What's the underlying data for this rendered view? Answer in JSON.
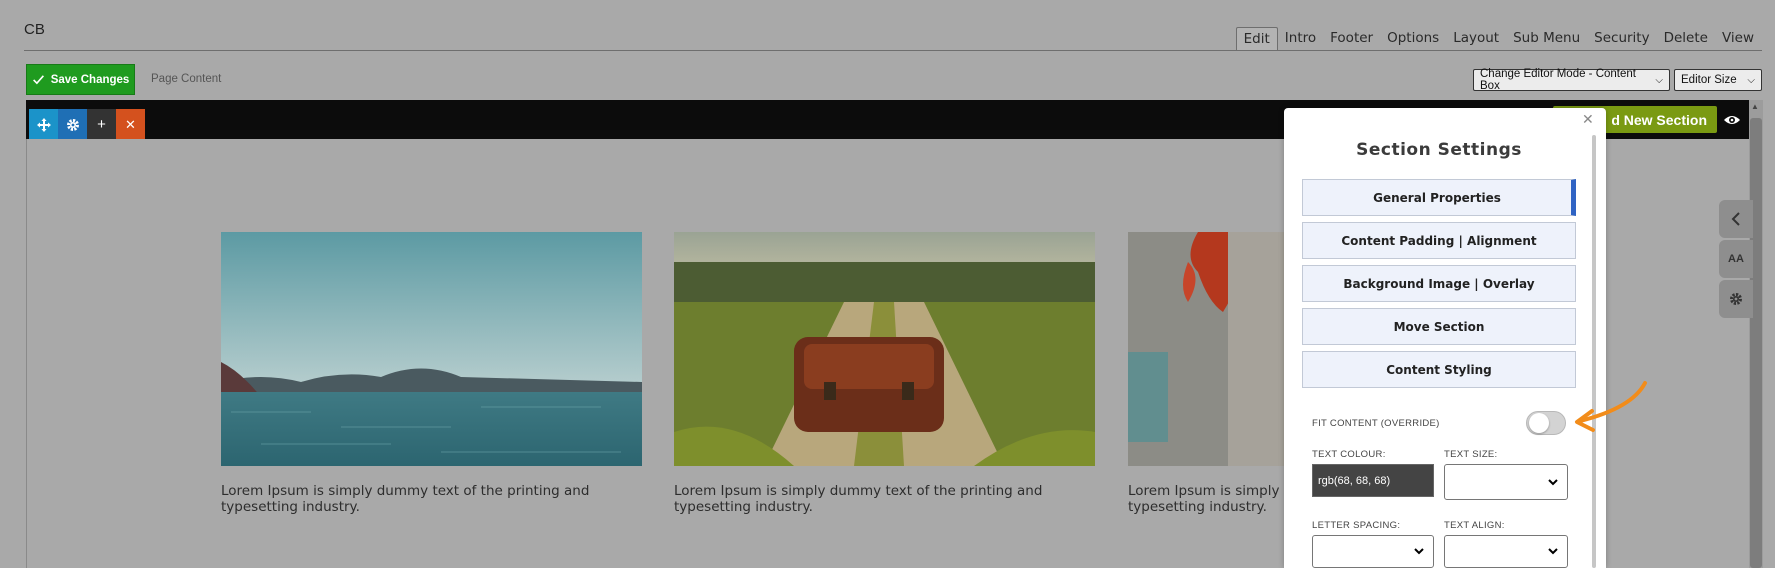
{
  "header": {
    "site_name": "CB",
    "tabs": [
      {
        "label": "Edit",
        "active": true
      },
      {
        "label": "Intro"
      },
      {
        "label": "Footer"
      },
      {
        "label": "Options"
      },
      {
        "label": "Layout"
      },
      {
        "label": "Sub Menu"
      },
      {
        "label": "Security"
      },
      {
        "label": "Delete"
      },
      {
        "label": "View"
      }
    ]
  },
  "toolbar": {
    "save_label": "Save Changes",
    "page_content_label": "Page Content",
    "editor_mode_select": "Change Editor Mode - Content Box",
    "editor_size_select": "Editor Size"
  },
  "section_bar": {
    "add_section_label": "d New Section",
    "tool_icons": [
      "move-icon",
      "gear-icon",
      "plus-icon",
      "close-icon"
    ]
  },
  "cards": [
    {
      "text": "Lorem Ipsum is simply dummy text of the printing and typesetting industry.",
      "image": "sea-landscape"
    },
    {
      "text": "Lorem Ipsum is simply dummy text of the printing and typesetting industry.",
      "image": "leather-bag-on-path"
    },
    {
      "text": "Lorem Ipsum is simply",
      "text2": "typesetting industry.",
      "image": "red-leaf"
    }
  ],
  "side_tabs": [
    {
      "icon": "chevron-left-icon"
    },
    {
      "icon": "font-size-icon",
      "label": "AA"
    },
    {
      "icon": "gear-icon"
    }
  ],
  "panel": {
    "title": "Section Settings",
    "buttons": [
      {
        "label": "General Properties",
        "active": true
      },
      {
        "label": "Content Padding | Alignment"
      },
      {
        "label": "Background Image | Overlay"
      },
      {
        "label": "Move Section"
      },
      {
        "label": "Content Styling"
      }
    ],
    "fit_content_label": "FIT CONTENT (OVERRIDE)",
    "fit_content_on": false,
    "text_colour_label": "TEXT COLOUR:",
    "text_colour_value": "rgb(68, 68, 68)",
    "text_size_label": "TEXT SIZE:",
    "letter_spacing_label": "LETTER SPACING:",
    "text_align_label": "TEXT ALIGN:"
  },
  "colors": {
    "save_green": "#1f9b1f",
    "add_section_green": "#7a9a12",
    "move_tool": "#1b93c9",
    "gear_tool": "#1f6fb5",
    "plus_tool": "#333333",
    "close_tool": "#d4511e",
    "annotation_arrow": "#f28c1a",
    "active_tab_accent": "#2f63c4"
  }
}
